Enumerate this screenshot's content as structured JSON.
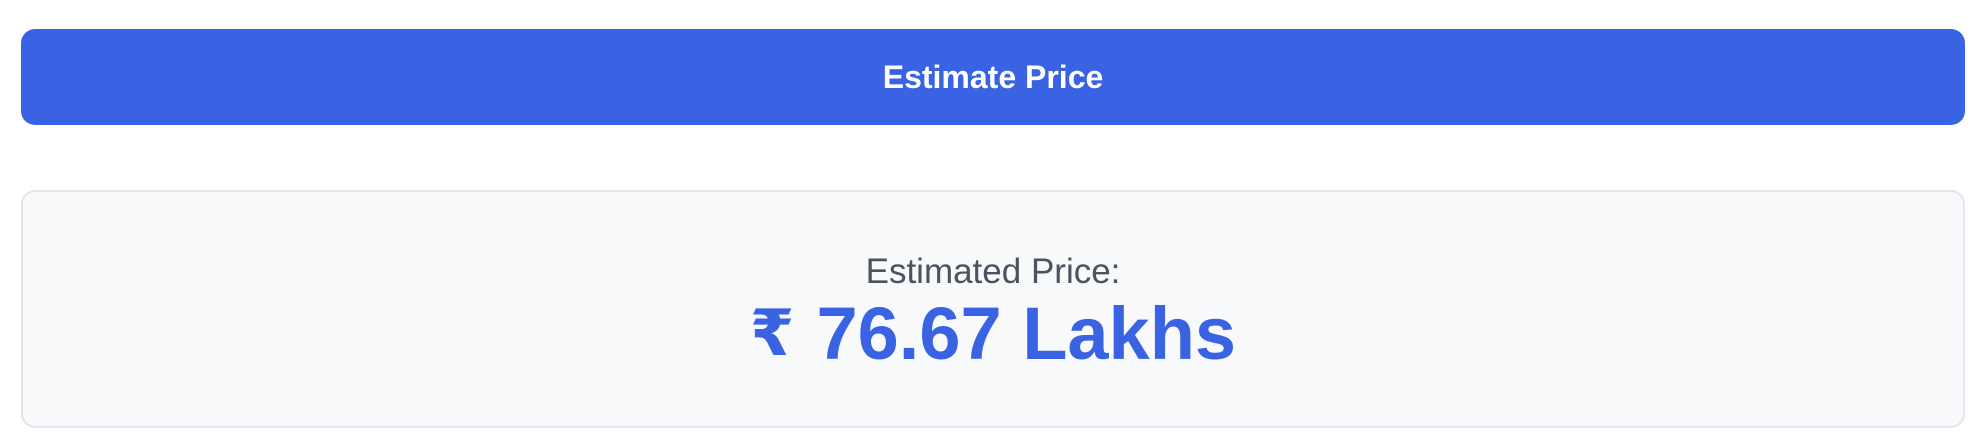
{
  "form": {
    "submit_label": "Estimate Price"
  },
  "result": {
    "label": "Estimated Price:",
    "currency_symbol": "₹",
    "amount": "76.67",
    "unit": "Lakhs"
  },
  "colors": {
    "accent": "#3a63e3",
    "card_background": "#f8f9fb",
    "card_border": "#e2e6ec",
    "label_text": "#4b5260"
  }
}
